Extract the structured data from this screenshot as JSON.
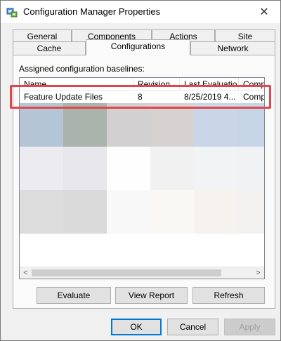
{
  "window": {
    "title": "Configuration Manager Properties",
    "close_glyph": "✕",
    "app_icon": "configuration-manager-icon"
  },
  "tabs": {
    "row1": [
      "General",
      "Components",
      "Actions",
      "Site"
    ],
    "row2": [
      "Cache",
      "Configurations",
      "Network"
    ],
    "active": "Configurations"
  },
  "group": {
    "label": "Assigned configuration baselines:"
  },
  "list": {
    "columns": [
      "Name",
      "Revision",
      "Last Evaluatio...",
      "Comp"
    ],
    "rows": [
      {
        "name": "Feature Update Files",
        "revision": "8",
        "last_evaluation": "8/25/2019 4...",
        "compliance": "Comp"
      }
    ]
  },
  "scrollbar": {
    "left_glyph": "<",
    "right_glyph": ">"
  },
  "panel_buttons": {
    "evaluate": "Evaluate",
    "view_report": "View Report",
    "refresh": "Refresh"
  },
  "dialog_buttons": {
    "ok": "OK",
    "cancel": "Cancel",
    "apply": "Apply"
  },
  "colors": {
    "highlight": "#e0474c",
    "default_button_border": "#0078d7"
  }
}
